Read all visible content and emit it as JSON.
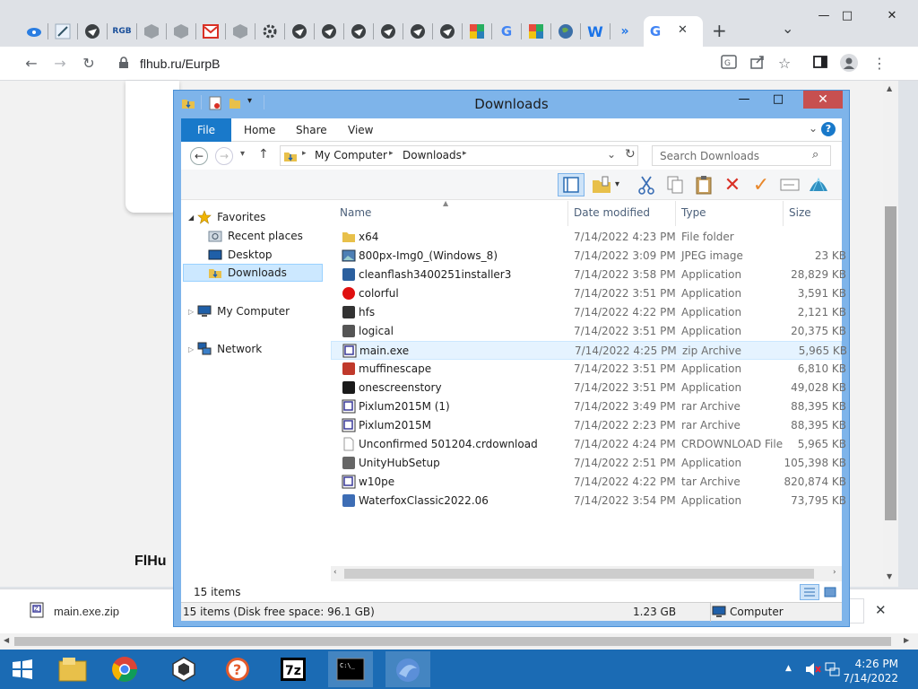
{
  "browser": {
    "url": "flhub.ru/EurpB",
    "active_tab_close": "✕",
    "new_tab": "+",
    "tab_list": "⌄"
  },
  "page": {
    "heading": "FlHu"
  },
  "download_bar": {
    "filename": "main.exe.zip",
    "close": "✕"
  },
  "explorer": {
    "title": "Downloads",
    "ribbon_tabs": [
      "File",
      "Home",
      "Share",
      "View"
    ],
    "breadcrumb": [
      "My Computer",
      "Downloads"
    ],
    "search_placeholder": "Search Downloads",
    "nav": {
      "favorites": "Favorites",
      "recent_places": "Recent places",
      "desktop": "Desktop",
      "downloads": "Downloads",
      "my_computer": "My Computer",
      "network": "Network"
    },
    "columns": [
      "Name",
      "Date modified",
      "Type",
      "Size"
    ],
    "files": [
      {
        "name": "x64",
        "date": "7/14/2022 4:23 PM",
        "type": "File folder",
        "size": "",
        "icon": "folder-icon",
        "color": "#e8c04a"
      },
      {
        "name": "800px-Img0_(Windows_8)",
        "date": "7/14/2022 3:09 PM",
        "type": "JPEG image",
        "size": "23 KB",
        "icon": "image-icon",
        "color": "#4d7fb5"
      },
      {
        "name": "cleanflash3400251installer3",
        "date": "7/14/2022 3:58 PM",
        "type": "Application",
        "size": "28,829 KB",
        "icon": "flash-app-icon",
        "color": "#2b5f9e"
      },
      {
        "name": "colorful",
        "date": "7/14/2022 3:51 PM",
        "type": "Application",
        "size": "3,591 KB",
        "icon": "red-circle-app-icon",
        "color": "#e01010"
      },
      {
        "name": "hfs",
        "date": "7/14/2022 4:22 PM",
        "type": "Application",
        "size": "2,121 KB",
        "icon": "hfs-app-icon",
        "color": "#333333"
      },
      {
        "name": "logical",
        "date": "7/14/2022 3:51 PM",
        "type": "Application",
        "size": "20,375 KB",
        "icon": "logical-app-icon",
        "color": "#555555"
      },
      {
        "name": "main.exe",
        "date": "7/14/2022 4:25 PM",
        "type": "zip Archive",
        "size": "5,965 KB",
        "icon": "zip-archive-icon",
        "color": "#3a3a9a"
      },
      {
        "name": "muffinescape",
        "date": "7/14/2022 3:51 PM",
        "type": "Application",
        "size": "6,810 KB",
        "icon": "muffin-app-icon",
        "color": "#c0392b"
      },
      {
        "name": "onescreenstory",
        "date": "7/14/2022 3:51 PM",
        "type": "Application",
        "size": "49,028 KB",
        "icon": "onescreen-app-icon",
        "color": "#1a1a1a"
      },
      {
        "name": "Pixlum2015M (1)",
        "date": "7/14/2022 3:49 PM",
        "type": "rar Archive",
        "size": "88,395 KB",
        "icon": "rar-archive-icon",
        "color": "#3a3a9a"
      },
      {
        "name": "Pixlum2015M",
        "date": "7/14/2022 2:23 PM",
        "type": "rar Archive",
        "size": "88,395 KB",
        "icon": "rar-archive-icon",
        "color": "#3a3a9a"
      },
      {
        "name": "Unconfirmed 501204.crdownload",
        "date": "7/14/2022 4:24 PM",
        "type": "CRDOWNLOAD File",
        "size": "5,965 KB",
        "icon": "blank-file-icon",
        "color": "#ffffff"
      },
      {
        "name": "UnityHubSetup",
        "date": "7/14/2022 2:51 PM",
        "type": "Application",
        "size": "105,398 KB",
        "icon": "unity-app-icon",
        "color": "#666666"
      },
      {
        "name": "w10pe",
        "date": "7/14/2022 4:22 PM",
        "type": "tar Archive",
        "size": "820,874 KB",
        "icon": "tar-archive-icon",
        "color": "#3a3a9a"
      },
      {
        "name": "WaterfoxClassic2022.06",
        "date": "7/14/2022 3:54 PM",
        "type": "Application",
        "size": "73,795 KB",
        "icon": "waterfox-app-icon",
        "color": "#3d6db5"
      }
    ],
    "item_count": "15 items",
    "status": {
      "summary": "15 items (Disk free space: 96.1 GB)",
      "size": "1.23 GB",
      "location": "Computer"
    }
  },
  "taskbar": {
    "time": "4:26 PM",
    "date": "7/14/2022"
  }
}
